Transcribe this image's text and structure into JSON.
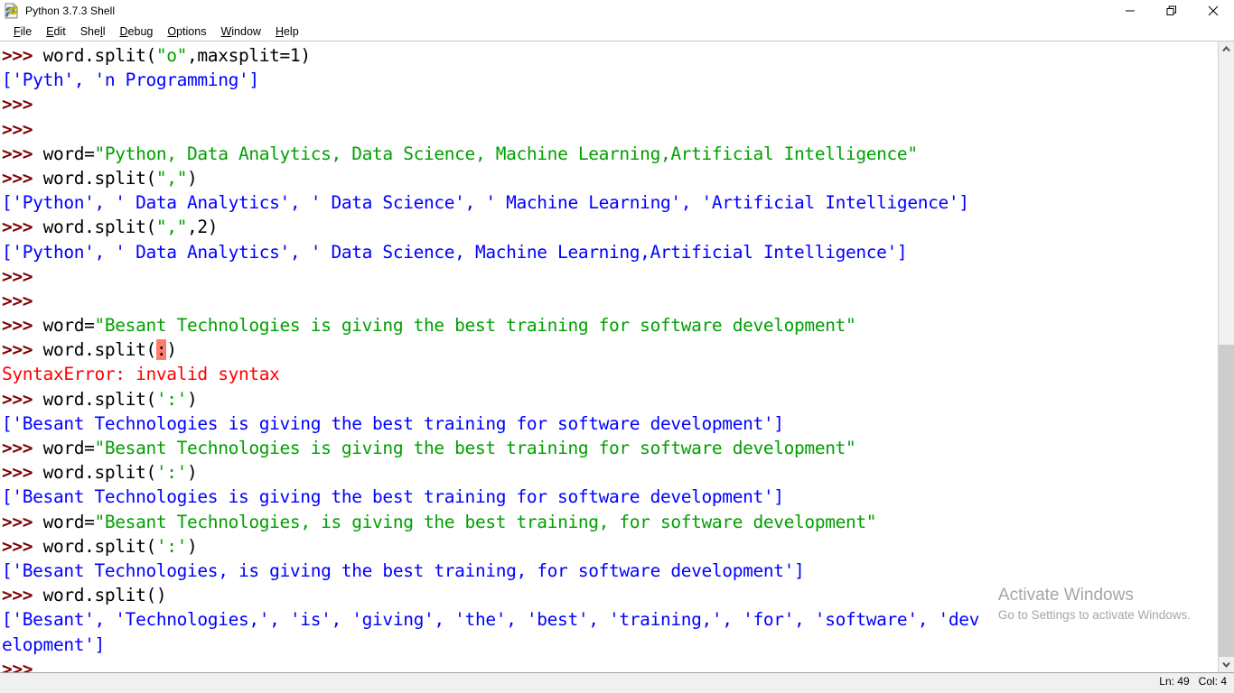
{
  "window": {
    "title": "Python 3.7.3 Shell",
    "icon": "python-file-icon",
    "controls": {
      "minimize": "minimize-icon",
      "restore": "restore-icon",
      "close": "close-icon"
    }
  },
  "menubar": {
    "items": [
      {
        "label": "File",
        "accel": "F"
      },
      {
        "label": "Edit",
        "accel": "E"
      },
      {
        "label": "Shell",
        "accel": "l"
      },
      {
        "label": "Debug",
        "accel": "D"
      },
      {
        "label": "Options",
        "accel": "O"
      },
      {
        "label": "Window",
        "accel": "W"
      },
      {
        "label": "Help",
        "accel": "H"
      }
    ]
  },
  "shell": {
    "prompt": ">>> ",
    "lines": [
      {
        "type": "input",
        "segments": [
          {
            "t": ">>> ",
            "c": "prompt"
          },
          {
            "t": "word.split(",
            "c": "code"
          },
          {
            "t": "\"o\"",
            "c": "str"
          },
          {
            "t": ",maxsplit=1)",
            "c": "code"
          }
        ]
      },
      {
        "type": "output",
        "segments": [
          {
            "t": "['Pyth', 'n Programming']",
            "c": "out"
          }
        ]
      },
      {
        "type": "prompt",
        "segments": [
          {
            "t": ">>> ",
            "c": "prompt"
          }
        ]
      },
      {
        "type": "prompt",
        "segments": [
          {
            "t": ">>> ",
            "c": "prompt"
          }
        ]
      },
      {
        "type": "input",
        "segments": [
          {
            "t": ">>> ",
            "c": "prompt"
          },
          {
            "t": "word=",
            "c": "code"
          },
          {
            "t": "\"Python, Data Analytics, Data Science, Machine Learning,Artificial Intelligence\"",
            "c": "str"
          }
        ]
      },
      {
        "type": "input",
        "segments": [
          {
            "t": ">>> ",
            "c": "prompt"
          },
          {
            "t": "word.split(",
            "c": "code"
          },
          {
            "t": "\",\"",
            "c": "str"
          },
          {
            "t": ")",
            "c": "code"
          }
        ]
      },
      {
        "type": "output",
        "segments": [
          {
            "t": "['Python', ' Data Analytics', ' Data Science', ' Machine Learning', 'Artificial Intelligence']",
            "c": "out"
          }
        ]
      },
      {
        "type": "input",
        "segments": [
          {
            "t": ">>> ",
            "c": "prompt"
          },
          {
            "t": "word.split(",
            "c": "code"
          },
          {
            "t": "\",\"",
            "c": "str"
          },
          {
            "t": ",2)",
            "c": "code"
          }
        ]
      },
      {
        "type": "output",
        "segments": [
          {
            "t": "['Python', ' Data Analytics', ' Data Science, Machine Learning,Artificial Intelligence']",
            "c": "out"
          }
        ]
      },
      {
        "type": "prompt",
        "segments": [
          {
            "t": ">>> ",
            "c": "prompt"
          }
        ]
      },
      {
        "type": "prompt",
        "segments": [
          {
            "t": ">>> ",
            "c": "prompt"
          }
        ]
      },
      {
        "type": "input",
        "segments": [
          {
            "t": ">>> ",
            "c": "prompt"
          },
          {
            "t": "word=",
            "c": "code"
          },
          {
            "t": "\"Besant Technologies is giving the best training for software development\"",
            "c": "str"
          }
        ]
      },
      {
        "type": "input",
        "segments": [
          {
            "t": ">>> ",
            "c": "prompt"
          },
          {
            "t": "word.split(",
            "c": "code"
          },
          {
            "t": ":",
            "c": "errhl"
          },
          {
            "t": ")",
            "c": "code"
          }
        ]
      },
      {
        "type": "error",
        "segments": [
          {
            "t": "SyntaxError: invalid syntax",
            "c": "err"
          }
        ]
      },
      {
        "type": "input",
        "segments": [
          {
            "t": ">>> ",
            "c": "prompt"
          },
          {
            "t": "word.split(",
            "c": "code"
          },
          {
            "t": "':'",
            "c": "str"
          },
          {
            "t": ")",
            "c": "code"
          }
        ]
      },
      {
        "type": "output",
        "segments": [
          {
            "t": "['Besant Technologies is giving the best training for software development']",
            "c": "out"
          }
        ]
      },
      {
        "type": "input",
        "segments": [
          {
            "t": ">>> ",
            "c": "prompt"
          },
          {
            "t": "word=",
            "c": "code"
          },
          {
            "t": "\"Besant Technologies is giving the best training for software development\"",
            "c": "str"
          }
        ]
      },
      {
        "type": "input",
        "segments": [
          {
            "t": ">>> ",
            "c": "prompt"
          },
          {
            "t": "word.split(",
            "c": "code"
          },
          {
            "t": "':'",
            "c": "str"
          },
          {
            "t": ")",
            "c": "code"
          }
        ]
      },
      {
        "type": "output",
        "segments": [
          {
            "t": "['Besant Technologies is giving the best training for software development']",
            "c": "out"
          }
        ]
      },
      {
        "type": "input",
        "segments": [
          {
            "t": ">>> ",
            "c": "prompt"
          },
          {
            "t": "word=",
            "c": "code"
          },
          {
            "t": "\"Besant Technologies, is giving the best training, for software development\"",
            "c": "str"
          }
        ]
      },
      {
        "type": "input",
        "segments": [
          {
            "t": ">>> ",
            "c": "prompt"
          },
          {
            "t": "word.split(",
            "c": "code"
          },
          {
            "t": "':'",
            "c": "str"
          },
          {
            "t": ")",
            "c": "code"
          }
        ]
      },
      {
        "type": "output",
        "segments": [
          {
            "t": "['Besant Technologies, is giving the best training, for software development']",
            "c": "out"
          }
        ]
      },
      {
        "type": "input",
        "segments": [
          {
            "t": ">>> ",
            "c": "prompt"
          },
          {
            "t": "word.split()",
            "c": "code"
          }
        ]
      },
      {
        "type": "output",
        "segments": [
          {
            "t": "['Besant', 'Technologies,', 'is', 'giving', 'the', 'best', 'training,', 'for', 'software', 'dev",
            "c": "out"
          }
        ]
      },
      {
        "type": "output",
        "segments": [
          {
            "t": "elopment']",
            "c": "out"
          }
        ]
      },
      {
        "type": "prompt",
        "segments": [
          {
            "t": ">>> ",
            "c": "prompt"
          }
        ]
      }
    ]
  },
  "watermark": {
    "title": "Activate Windows",
    "subtitle": "Go to Settings to activate Windows."
  },
  "statusbar": {
    "position": "Ln: 49   Col: 4",
    "line": 49,
    "col": 4
  },
  "colors": {
    "prompt": "#7f0000",
    "code": "#000000",
    "string": "#00a000",
    "output": "#0000ff",
    "error": "#ff0000",
    "error_highlight": "#ff7b6b",
    "background": "#ffffff"
  },
  "scrollbar": {
    "up_arrow": "chevron-up-icon",
    "down_arrow": "chevron-down-icon"
  }
}
